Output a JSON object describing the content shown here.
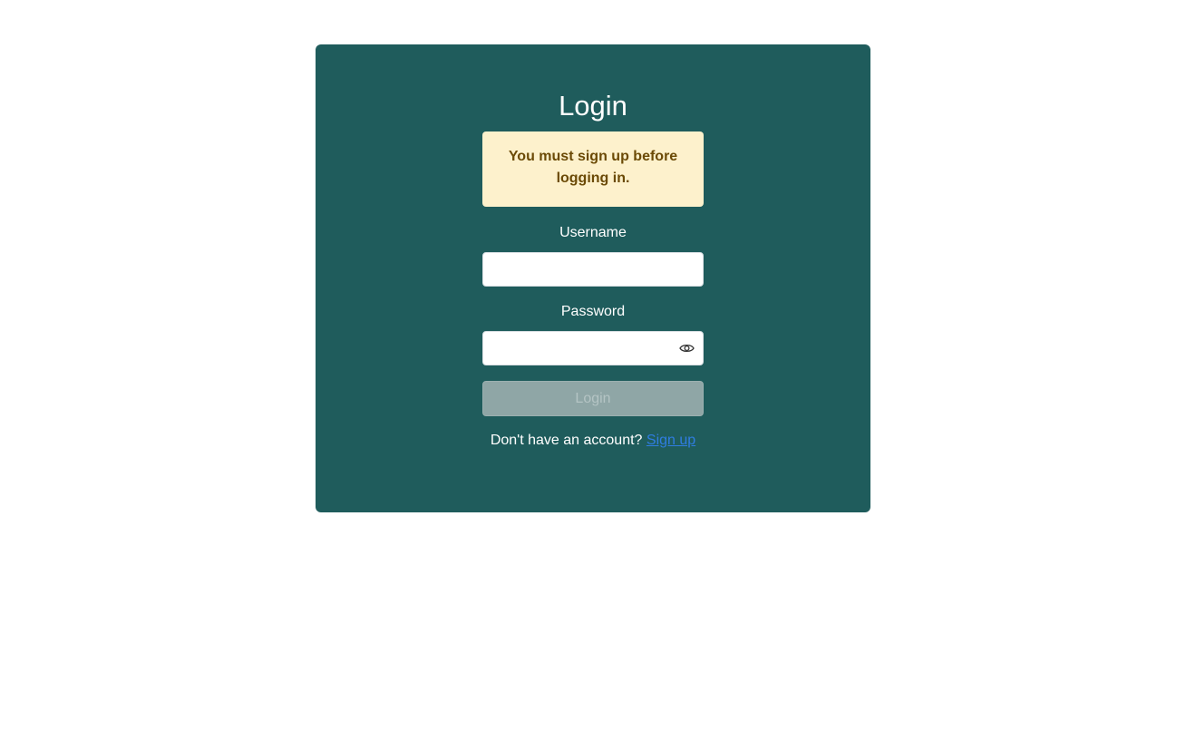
{
  "login_form": {
    "title": "Login",
    "alert_message": "You must sign up before logging in.",
    "username": {
      "label": "Username",
      "value": ""
    },
    "password": {
      "label": "Password",
      "value": "",
      "toggle_icon": "eye-icon"
    },
    "submit_label": "Login",
    "submit_enabled": false,
    "signup_prompt": "Don't have an account?",
    "signup_link": "Sign up"
  },
  "colors": {
    "card_background": "#1f5c5c",
    "alert_background": "#fdf1cc",
    "alert_text": "#6b4a06",
    "disabled_button": "#8fa6a6",
    "link": "#2f7de1"
  }
}
